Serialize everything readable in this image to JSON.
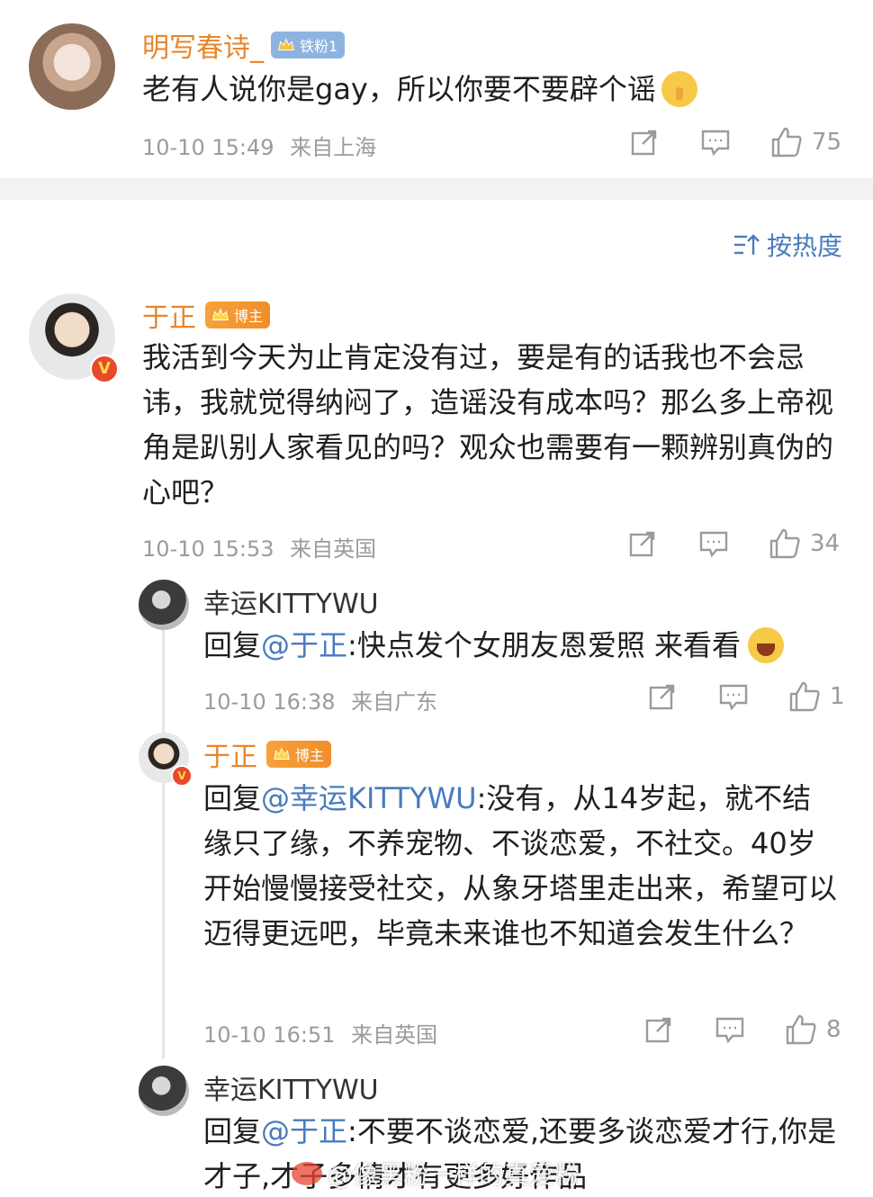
{
  "comment1": {
    "user": "明写春诗_",
    "badge": "铁粉1",
    "text": "老有人说你是gay，所以你要不要辟个谣",
    "time": "10-10 15:49",
    "location": "来自上海",
    "likes": "75"
  },
  "sort": {
    "label": "按热度"
  },
  "comment2": {
    "user": "于正",
    "badge": "博主",
    "text": "我活到今天为止肯定没有过，要是有的话我也不会忌讳，我就觉得纳闷了，造谣没有成本吗？那么多上帝视角是趴别人家看见的吗？观众也需要有一颗辨别真伪的心吧？",
    "time": "10-10 15:53",
    "location": "来自英国",
    "likes": "34"
  },
  "reply1": {
    "user": "幸运KITTYWU",
    "prefix": "回复",
    "mention": "@于正",
    "text": ":快点发个女朋友恩爱照 来看看",
    "time": "10-10 16:38",
    "location": "来自广东",
    "likes": "1"
  },
  "reply2": {
    "user": "于正",
    "badge": "博主",
    "prefix": "回复",
    "mention": "@幸运KITTYWU",
    "text": ":没有，从14岁起，就不结缘只了缘，不养宠物、不谈恋爱，不社交。40岁开始慢慢接受社交，从象牙塔里走出来，希望可以迈得更远吧，毕竟未来谁也不知道会发生什么？",
    "time": "10-10 16:51",
    "location": "来自英国",
    "likes": "8"
  },
  "reply3": {
    "user": "幸运KITTYWU",
    "prefix": "回复",
    "mention": "@于正",
    "text": ":不要不谈恋爱,还要多谈恋爱才行,你是才子,才子多情才有更多好作品"
  },
  "watermark": {
    "text": "@像黑粉一样的真爱粉"
  },
  "colors": {
    "name": "#e8852d",
    "mention": "#4a7bbd",
    "meta": "#9b9b9b",
    "badge": "#f39a30"
  }
}
